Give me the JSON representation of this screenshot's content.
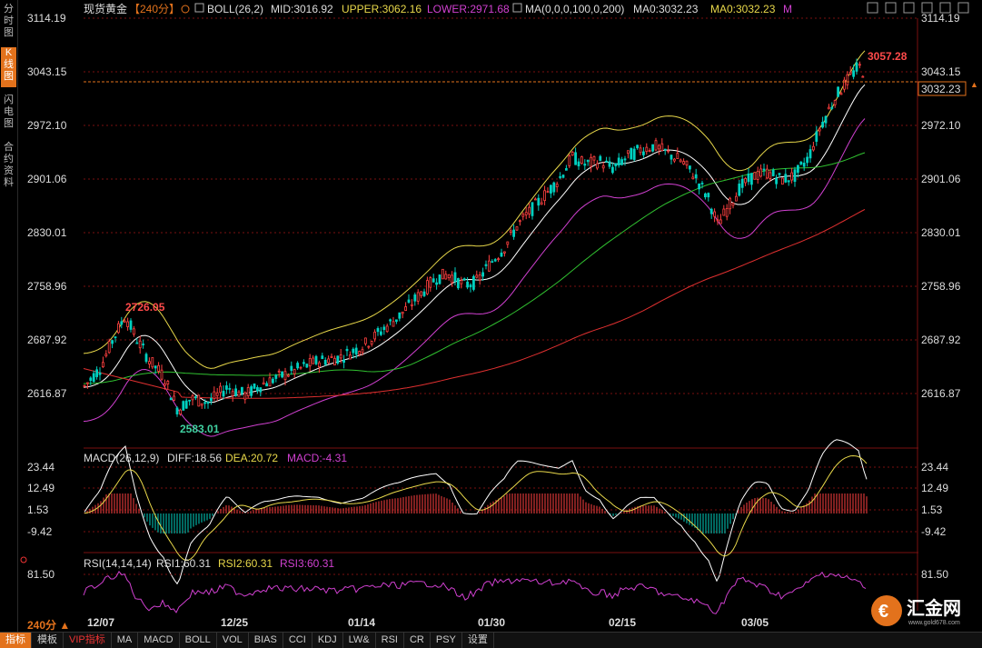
{
  "sidebar": {
    "tabs": [
      {
        "label": "分时图",
        "active": false
      },
      {
        "label": "K线图",
        "active": true
      },
      {
        "label": "闪电图",
        "active": false
      },
      {
        "label": "合约资料",
        "active": false
      }
    ]
  },
  "header": {
    "name": "现货黄金",
    "period": "【240分】",
    "boll": "BOLL(26,2)",
    "mid": "MID:3016.92",
    "upper": "UPPER:3062.16",
    "lower": "LOWER:2971.68",
    "ma": "MA(0,0,0,100,0,200)",
    "ma0a": "MA0:3032.23",
    "ma0b": "MA0:3032.23",
    "m": "M"
  },
  "price_axis": {
    "labels": [
      "3114.19",
      "3043.15",
      "2972.10",
      "2901.06",
      "2830.01",
      "2758.96",
      "2687.92",
      "2616.87"
    ],
    "current": "3032.23"
  },
  "annotations": {
    "high": "3057.28",
    "left_high": "2726.05",
    "low": "2583.01"
  },
  "macd": {
    "title": "MACD(26,12,9)",
    "diff": "DIFF:18.56",
    "dea": "DEA:20.72",
    "macd": "MACD:-4.31",
    "labels": [
      "23.44",
      "12.49",
      "1.53",
      "-9.42"
    ]
  },
  "rsi": {
    "title": "RSI(14,14,14)",
    "rsi1": "RSI1:60.31",
    "rsi2": "RSI2:60.31",
    "rsi3": "RSI3:60.31",
    "label": "81.50"
  },
  "dates": [
    "12/07",
    "12/25",
    "01/14",
    "01/30",
    "02/15",
    "03/05"
  ],
  "period_label": "240分 ▲",
  "bottom_tabs": [
    "指标",
    "模板",
    "VIP指标",
    "MA",
    "MACD",
    "BOLL",
    "VOL",
    "BIAS",
    "CCI",
    "KDJ",
    "LW&",
    "RSI",
    "CR",
    "PSY",
    "设置"
  ],
  "logo": {
    "text": "汇金网",
    "url": "www.gold678.com"
  },
  "colors": {
    "up": "#ff4040",
    "down": "#00d0c0",
    "mid": "#ffffff",
    "upper": "#e8d84a",
    "lower": "#d040d0",
    "ma100": "#30c030",
    "ma200": "#e03030",
    "accent": "#e3721c"
  }
}
